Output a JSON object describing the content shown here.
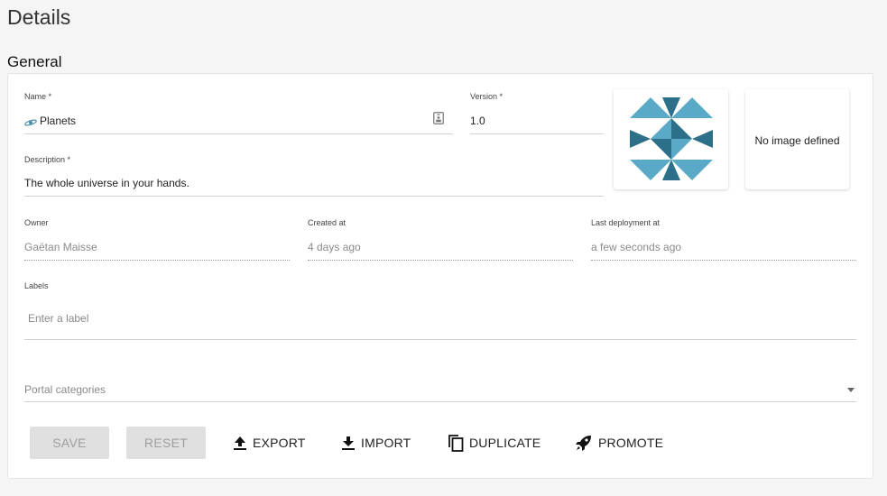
{
  "page": {
    "title": "Details"
  },
  "section": {
    "title": "General"
  },
  "form": {
    "name": {
      "label": "Name *",
      "value": "Planets"
    },
    "version": {
      "label": "Version *",
      "value": "1.0"
    },
    "description": {
      "label": "Description *",
      "value": "The whole universe in your hands."
    },
    "owner": {
      "label": "Owner",
      "value": "Gaëtan Maisse"
    },
    "created_at": {
      "label": "Created at",
      "value": "4 days ago"
    },
    "last_deployment": {
      "label": "Last deployment at",
      "value": "a few seconds ago"
    },
    "labels": {
      "label": "Labels",
      "placeholder": "Enter a label"
    },
    "portal_categories": {
      "placeholder": "Portal categories"
    }
  },
  "images": {
    "background_text": "No image defined"
  },
  "actions": {
    "save": "SAVE",
    "reset": "RESET",
    "export": "EXPORT",
    "import": "IMPORT",
    "duplicate": "DUPLICATE",
    "promote": "PROMOTE"
  },
  "colors": {
    "avatar_light": "#5aa9c6",
    "avatar_dark": "#2b6f88"
  },
  "icons": [
    "api-logo-icon",
    "badge-icon",
    "avatar-pattern",
    "export-icon",
    "import-icon",
    "duplicate-icon",
    "promote-icon",
    "dropdown-arrow-icon"
  ]
}
